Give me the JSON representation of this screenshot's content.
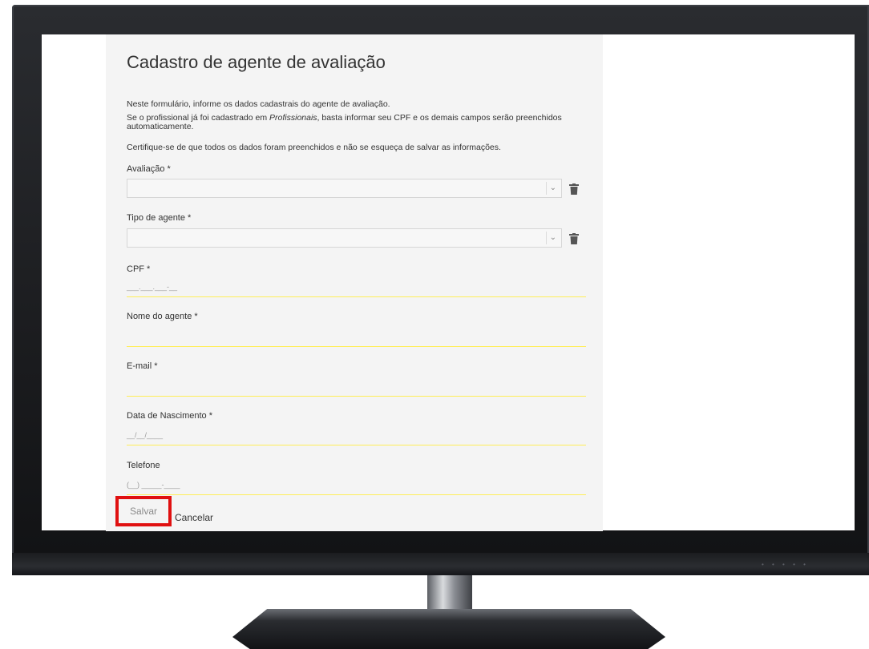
{
  "form": {
    "title": "Cadastro de agente de avaliação",
    "intro1": "Neste formulário, informe os dados cadastrais do agente de avaliação.",
    "intro2a": "Se o profissional já foi cadastrado em ",
    "intro2em": "Profissionais",
    "intro2b": ", basta informar seu CPF e os demais campos serão preenchidos automaticamente.",
    "intro3": "Certifique-se de que todos os dados foram preenchidos e não se esqueça de salvar as informações.",
    "avaliacao_label": "Avaliação *",
    "tipo_label": "Tipo de agente *",
    "cpf_label": "CPF *",
    "cpf_mask": "___.___.___-__",
    "nome_label": "Nome do agente *",
    "email_label": "E-mail *",
    "nascimento_label": "Data de Nascimento *",
    "nascimento_mask": "__/__/____",
    "telefone_label": "Telefone",
    "telefone_mask": "(__) _____-____",
    "save_label": "Salvar",
    "cancel_label": "Cancelar"
  },
  "icons": {
    "trash": "trash-icon",
    "caret": "chevron-down-icon"
  },
  "colors": {
    "highlight": "#e01010",
    "underline": "#ffee58",
    "panel": "#f4f4f4"
  }
}
